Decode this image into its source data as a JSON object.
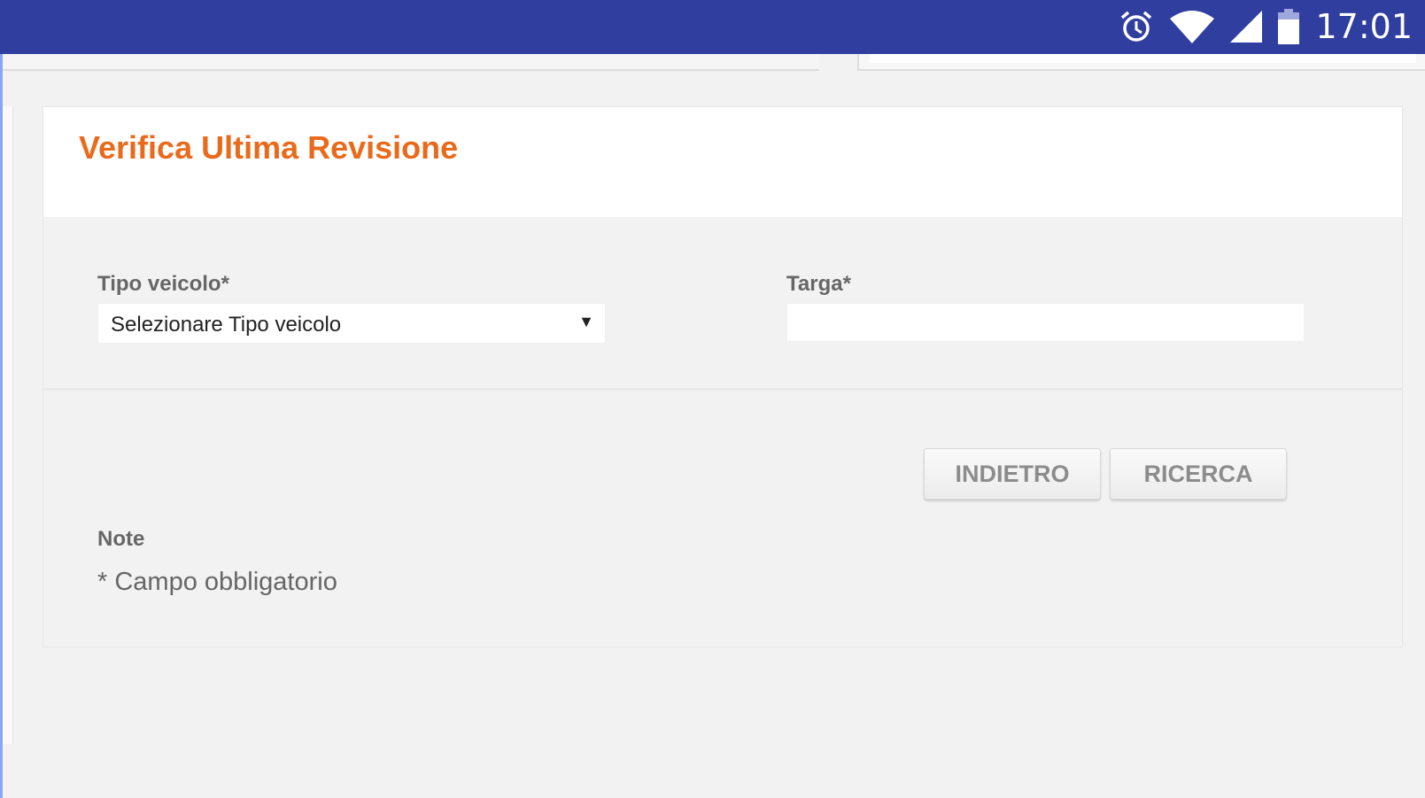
{
  "status_bar": {
    "time": "17:01",
    "icons": [
      "alarm-icon",
      "wifi-icon",
      "signal-icon",
      "battery-icon"
    ],
    "color": "#303f9f"
  },
  "page": {
    "title": "Verifica Ultima Revisione",
    "title_color": "#ea6a1c"
  },
  "form": {
    "vehicle_type": {
      "label": "Tipo veicolo*",
      "selected": "Selezionare Tipo veicolo",
      "arrow": "▼"
    },
    "plate": {
      "label": "Targa*",
      "value": ""
    }
  },
  "buttons": {
    "back": "INDIETRO",
    "search": "RICERCA"
  },
  "notes": {
    "heading": "Note",
    "required": "* Campo obbligatorio"
  }
}
